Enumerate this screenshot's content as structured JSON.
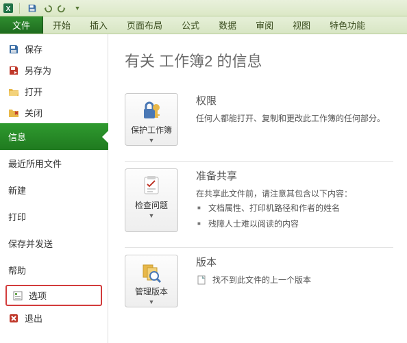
{
  "ribbon": {
    "file": "文件",
    "tabs": [
      "开始",
      "插入",
      "页面布局",
      "公式",
      "数据",
      "审阅",
      "视图",
      "特色功能"
    ]
  },
  "sidebar": {
    "items": [
      {
        "icon": "save-icon",
        "label": "保存"
      },
      {
        "icon": "saveas-icon",
        "label": "另存为"
      },
      {
        "icon": "open-icon",
        "label": "打开"
      },
      {
        "icon": "close-icon",
        "label": "关闭"
      },
      {
        "icon": null,
        "label": "信息",
        "active": true
      },
      {
        "icon": null,
        "label": "最近所用文件"
      },
      {
        "icon": null,
        "label": "新建"
      },
      {
        "icon": null,
        "label": "打印"
      },
      {
        "icon": null,
        "label": "保存并发送"
      },
      {
        "icon": null,
        "label": "帮助"
      },
      {
        "icon": "options-icon",
        "label": "选项",
        "boxed": true
      },
      {
        "icon": "exit-icon",
        "label": "退出"
      }
    ]
  },
  "page": {
    "title": "有关 工作簿2 的信息",
    "sections": [
      {
        "button": "保护工作簿",
        "heading": "权限",
        "text": "任何人都能打开、复制和更改此工作簿的任何部分。"
      },
      {
        "button": "检查问题",
        "heading": "准备共享",
        "intro": "在共享此文件前，请注意其包含以下内容：",
        "bullets": [
          "文档属性、打印机路径和作者的姓名",
          "残障人士难以阅读的内容"
        ]
      },
      {
        "button": "管理版本",
        "heading": "版本",
        "text": "找不到此文件的上一个版本"
      }
    ]
  }
}
